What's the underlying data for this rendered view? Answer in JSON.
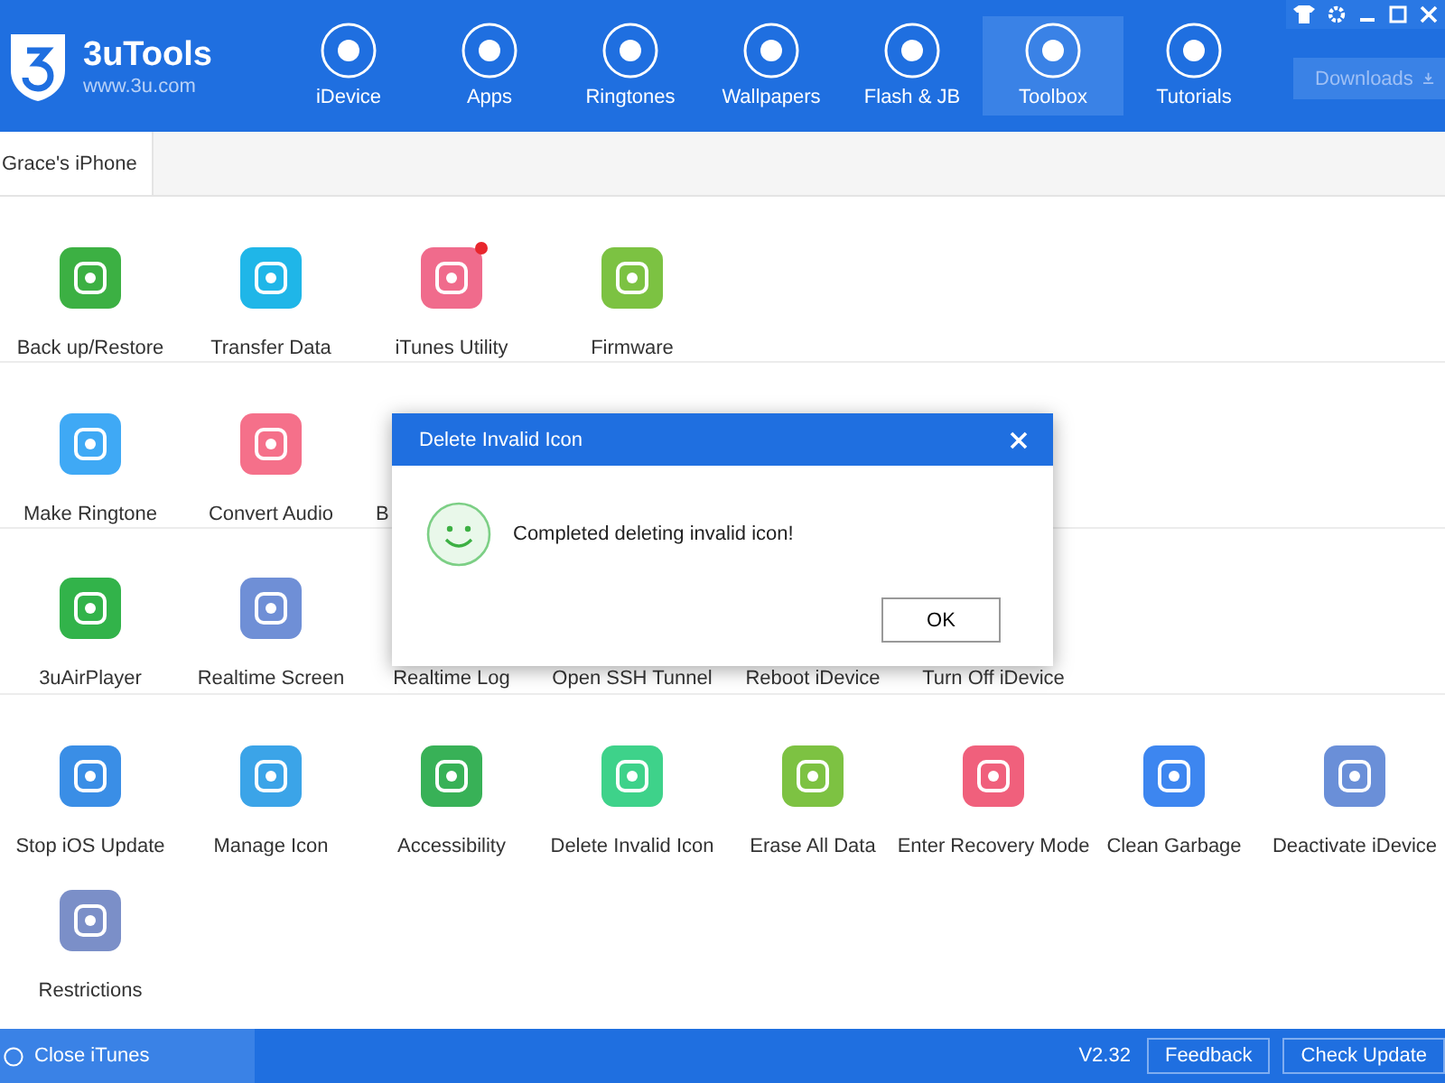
{
  "app": {
    "name": "3uTools",
    "url": "www.3u.com"
  },
  "nav": [
    {
      "label": "iDevice",
      "selected": false
    },
    {
      "label": "Apps",
      "selected": false
    },
    {
      "label": "Ringtones",
      "selected": false
    },
    {
      "label": "Wallpapers",
      "selected": false
    },
    {
      "label": "Flash & JB",
      "selected": false
    },
    {
      "label": "Toolbox",
      "selected": true
    },
    {
      "label": "Tutorials",
      "selected": false
    }
  ],
  "downloads": "Downloads",
  "device_tab": "Grace's iPhone",
  "sections": [
    [
      {
        "kind": "tile",
        "label": "Back up/Restore",
        "color": "#3cb043",
        "badge": false
      },
      {
        "kind": "tile",
        "label": "Transfer Data",
        "color": "#1fb6e8",
        "badge": false
      },
      {
        "kind": "tile",
        "label": "iTunes Utility",
        "color": "#f06b8c",
        "badge": true
      },
      {
        "kind": "tile",
        "label": "Firmware",
        "color": "#7cc242",
        "badge": false
      }
    ],
    [
      {
        "kind": "tile",
        "label": "Make Ringtone",
        "color": "#3fa9f5",
        "badge": false
      },
      {
        "kind": "tile",
        "label": "Convert Audio",
        "color": "#f5708a",
        "badge": false
      },
      {
        "kind": "covered",
        "label": "B"
      }
    ],
    [
      {
        "kind": "tile",
        "label": "3uAirPlayer",
        "color": "#32b34a",
        "badge": false
      },
      {
        "kind": "tile",
        "label": "Realtime Screen",
        "color": "#6f8fd6",
        "badge": false
      },
      {
        "kind": "covered",
        "label": "Realtime Log"
      },
      {
        "kind": "covered",
        "label": "Open SSH Tunnel"
      },
      {
        "kind": "covered",
        "label": "Reboot iDevice"
      },
      {
        "kind": "covered",
        "label": "Turn Off iDevice"
      }
    ],
    [
      {
        "kind": "tile",
        "label": "Stop iOS Update",
        "color": "#3a8ee6",
        "badge": false
      },
      {
        "kind": "tile",
        "label": "Manage Icon",
        "color": "#3ba4e8",
        "badge": false
      },
      {
        "kind": "tile",
        "label": "Accessibility",
        "color": "#38b157",
        "badge": false
      },
      {
        "kind": "tile",
        "label": "Delete Invalid Icon",
        "color": "#3ed28a",
        "badge": false
      },
      {
        "kind": "tile",
        "label": "Erase All Data",
        "color": "#7dc242",
        "badge": false
      },
      {
        "kind": "tile",
        "label": "Enter Recovery Mode",
        "color": "#f0607c",
        "badge": false
      },
      {
        "kind": "tile",
        "label": "Clean Garbage",
        "color": "#3d86f0",
        "badge": false
      },
      {
        "kind": "tile",
        "label": "Deactivate iDevice",
        "color": "#6a8fd8",
        "badge": false
      },
      {
        "kind": "tile",
        "label": "Restrictions",
        "color": "#7b8fc8",
        "badge": false
      }
    ]
  ],
  "dialog": {
    "title": "Delete Invalid Icon",
    "message": "Completed deleting invalid icon!",
    "button": "OK"
  },
  "status_bar": {
    "close_itunes": "Close iTunes",
    "version": "V2.32",
    "feedback": "Feedback",
    "check_update": "Check Update"
  }
}
